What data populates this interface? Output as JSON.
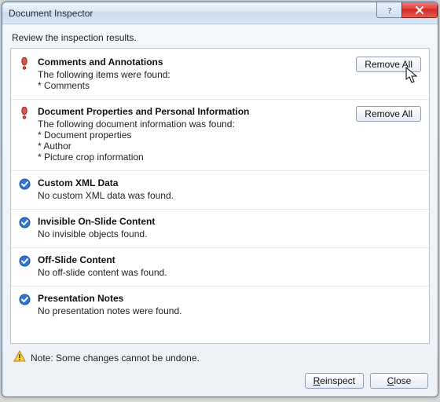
{
  "window": {
    "title": "Document Inspector"
  },
  "instruction": "Review the inspection results.",
  "sections": [
    {
      "status": "warn",
      "title": "Comments and Annotations",
      "desc": "The following items were found:",
      "items": [
        "* Comments"
      ],
      "action": "Remove All"
    },
    {
      "status": "warn",
      "title": "Document Properties and Personal Information",
      "desc": "The following document information was found:",
      "items": [
        "* Document properties",
        "* Author",
        "* Picture crop information"
      ],
      "action": "Remove All"
    },
    {
      "status": "ok",
      "title": "Custom XML Data",
      "desc": "No custom XML data was found."
    },
    {
      "status": "ok",
      "title": "Invisible On-Slide Content",
      "desc": "No invisible objects found."
    },
    {
      "status": "ok",
      "title": "Off-Slide Content",
      "desc": "No off-slide content was found."
    },
    {
      "status": "ok",
      "title": "Presentation Notes",
      "desc": "No presentation notes were found."
    }
  ],
  "footer": {
    "note": "Note: Some changes cannot be undone.",
    "reinspect": "Reinspect",
    "close": "Close"
  }
}
